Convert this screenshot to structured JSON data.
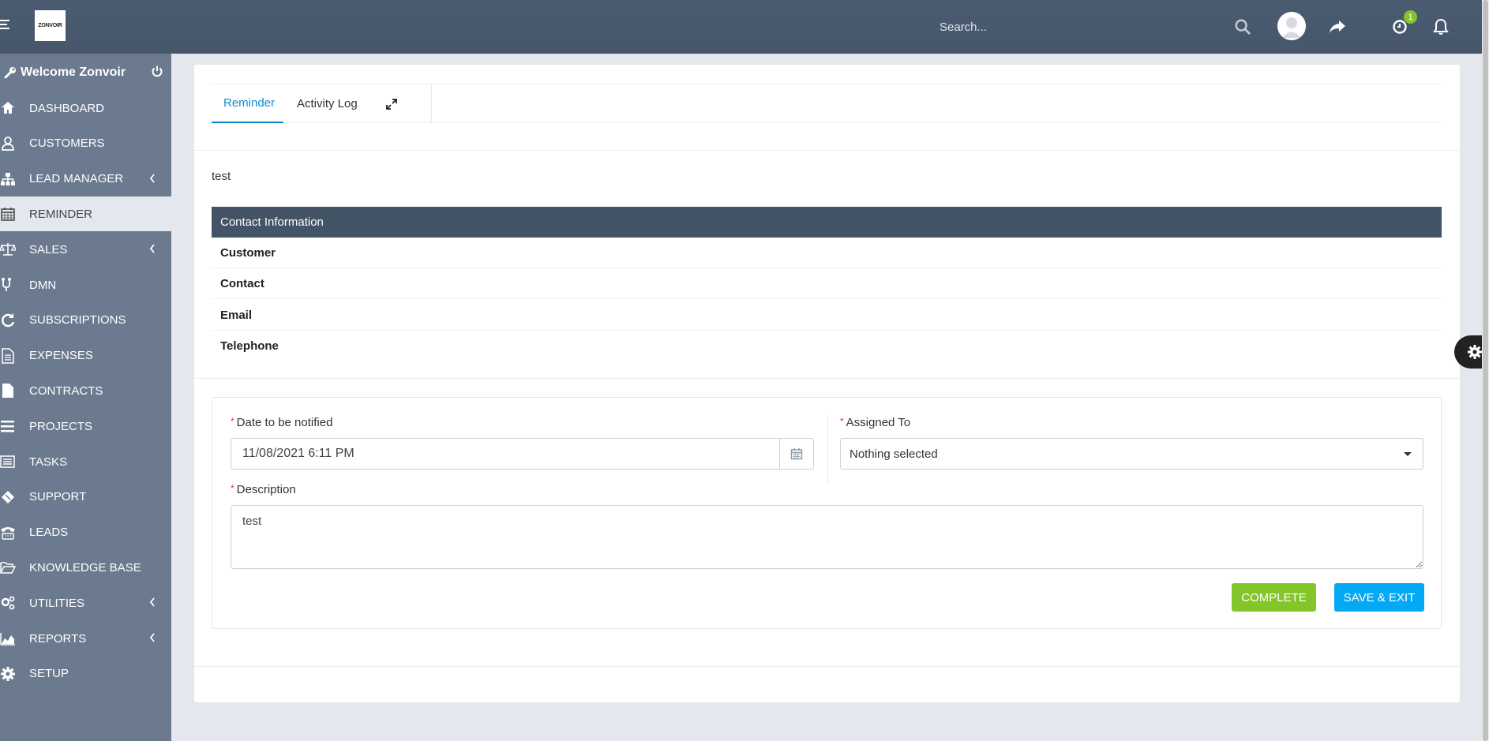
{
  "header": {
    "logo_text": "ZONVOIR",
    "search_placeholder": "Search...",
    "notification_count": "1"
  },
  "sidebar": {
    "welcome": "Welcome Zonvoir",
    "items": [
      {
        "label": "DASHBOARD",
        "icon": "home-icon"
      },
      {
        "label": "CUSTOMERS",
        "icon": "user-icon"
      },
      {
        "label": "LEAD MANAGER",
        "icon": "sitemap-icon",
        "submenu": true
      },
      {
        "label": "REMINDER",
        "icon": "calendar-icon",
        "active": true
      },
      {
        "label": "SALES",
        "icon": "balance-scale-icon",
        "submenu": true
      },
      {
        "label": "DMN",
        "icon": "fork-icon"
      },
      {
        "label": "SUBSCRIPTIONS",
        "icon": "refresh-icon"
      },
      {
        "label": "EXPENSES",
        "icon": "file-text-icon"
      },
      {
        "label": "CONTRACTS",
        "icon": "file-icon"
      },
      {
        "label": "PROJECTS",
        "icon": "bars-icon"
      },
      {
        "label": "TASKS",
        "icon": "tasks-icon"
      },
      {
        "label": "SUPPORT",
        "icon": "ticket-icon"
      },
      {
        "label": "LEADS",
        "icon": "tty-icon"
      },
      {
        "label": "KNOWLEDGE BASE",
        "icon": "folder-open-icon"
      },
      {
        "label": "UTILITIES",
        "icon": "cogs-icon",
        "submenu": true
      },
      {
        "label": "REPORTS",
        "icon": "area-chart-icon",
        "submenu": true
      },
      {
        "label": "SETUP",
        "icon": "cog-icon"
      }
    ]
  },
  "tabs": {
    "reminder": "Reminder",
    "activity_log": "Activity Log"
  },
  "reminder_title": "test",
  "contact": {
    "heading": "Contact Information",
    "rows": [
      "Customer",
      "Contact",
      "Email",
      "Telephone"
    ]
  },
  "form": {
    "date_label": "Date to be notified",
    "date_value": "11/08/2021 6:11 PM",
    "assigned_label": "Assigned To",
    "assigned_value": "Nothing selected",
    "description_label": "Description",
    "description_value": "test",
    "complete_label": "COMPLETE",
    "save_label": "SAVE & EXIT"
  },
  "colors": {
    "topbar": "#475569",
    "sidebar": "#6b7a8f",
    "accent": "#0b90d3",
    "complete": "#84c529",
    "save": "#03a9f4"
  }
}
